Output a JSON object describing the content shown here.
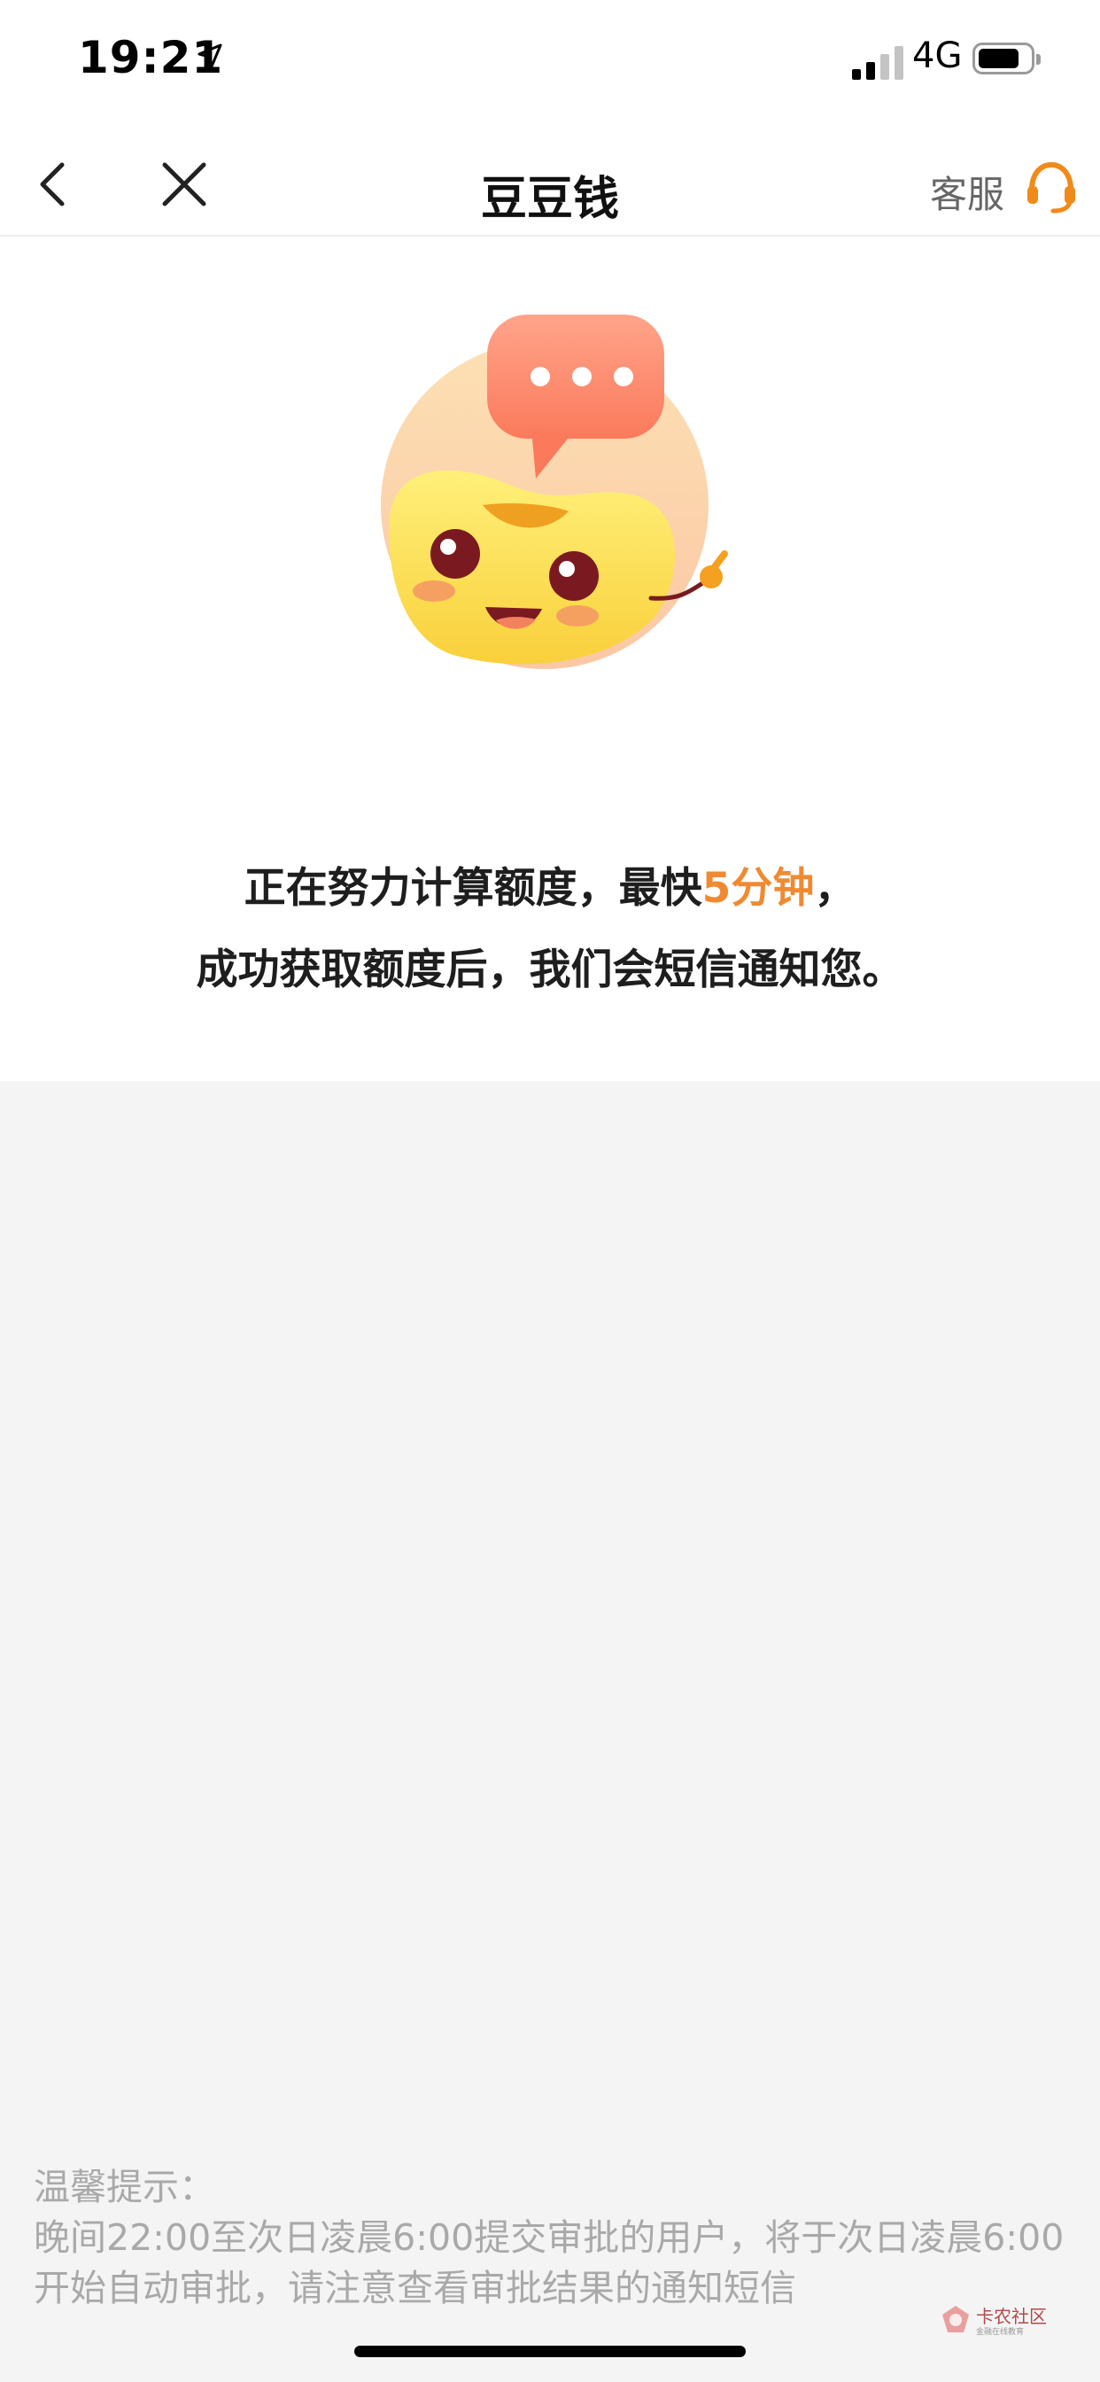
{
  "status_bar": {
    "time": "19:21",
    "network": "4G",
    "battery_level": 0.8,
    "signal_bars_active": 2,
    "signal_bars_total": 4
  },
  "nav": {
    "title": "豆豆钱",
    "service_label": "客服",
    "accent_color": "#f08a1a"
  },
  "main": {
    "line1_prefix": "正在努力计算额度，最快",
    "line1_highlight": "5分钟",
    "line1_suffix": "，",
    "line2": "成功获取额度后，我们会短信通知您。",
    "highlight_color": "#f08a32",
    "mascot_icon": "bean-mascot-with-chat-bubble"
  },
  "notice": {
    "title": "温馨提示：",
    "body": "晚间22:00至次日凌晨6:00提交审批的用户，将于次日凌晨6:00开始自动审批，请注意查看审批结果的通知短信"
  },
  "watermark": {
    "label": "卡农社区",
    "sub": "金融在线教育"
  }
}
